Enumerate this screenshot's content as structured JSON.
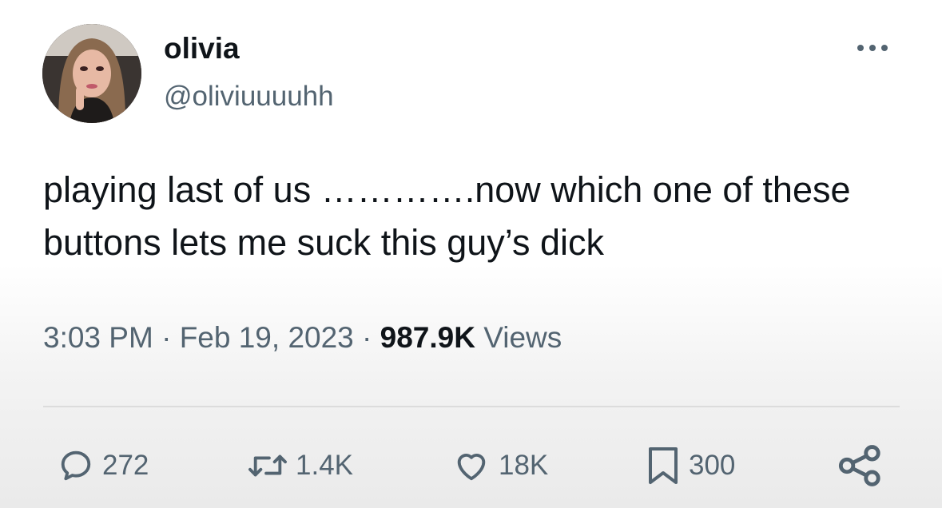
{
  "user": {
    "name": "olivia",
    "handle": "@oliviuuuuhh"
  },
  "tweet": {
    "text": "playing last of us ………….now which one of these buttons lets me suck this guy’s dick",
    "time": "3:03 PM",
    "date": "Feb 19, 2023",
    "separator": "·",
    "views_count": "987.9K",
    "views_label": "Views"
  },
  "actions": {
    "replies": "272",
    "retweets": "1.4K",
    "likes": "18K",
    "bookmarks": "300"
  },
  "icons": {
    "more": "more-horizontal-icon",
    "reply": "reply-icon",
    "retweet": "retweet-icon",
    "like": "heart-icon",
    "bookmark": "bookmark-icon",
    "share": "share-icon"
  },
  "colors": {
    "text": "#0f1419",
    "secondary": "#536471"
  }
}
